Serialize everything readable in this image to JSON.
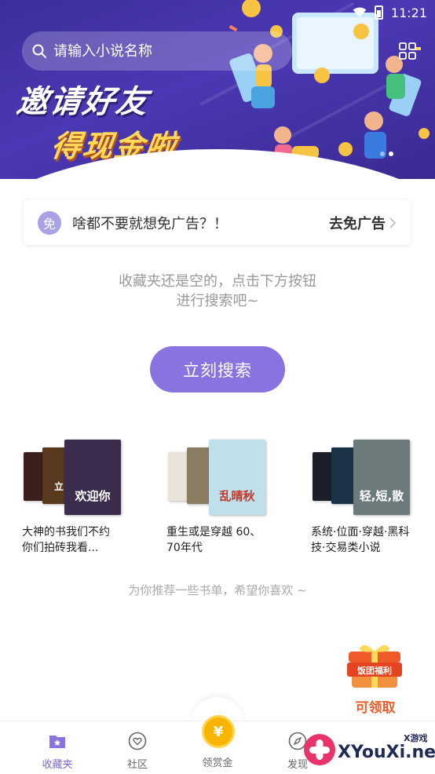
{
  "status": {
    "time": "11:21"
  },
  "search": {
    "placeholder": "请输入小说名称"
  },
  "banner": {
    "line1": "邀请好友",
    "line2": "得现金啦",
    "slide_count": 2,
    "active_slide": 2
  },
  "ad_free": {
    "badge": "免",
    "text": "啥都不要就想免广告？！",
    "action": "去免广告"
  },
  "empty_state": {
    "line1": "收藏夹还是空的，点击下方按钮",
    "line2": "进行搜索吧~",
    "button": "立刻搜索"
  },
  "book_lists": [
    {
      "title_line1": "大神的书我们不约",
      "title_line2": "你们拍砖我看...",
      "covers": [
        {
          "text": "",
          "color": "#3a1f1a"
        },
        {
          "text": "立",
          "color": "#5a3a1e"
        },
        {
          "text": "欢迎你",
          "color": "#3c2d4e"
        }
      ]
    },
    {
      "title_line1": "重生或是穿越 60、",
      "title_line2": "70年代",
      "covers": [
        {
          "text": "",
          "color": "#e9e4da"
        },
        {
          "text": "",
          "color": "#8b7d62"
        },
        {
          "text": "乱晴秋",
          "color": "#bfe0ea"
        }
      ]
    },
    {
      "title_line1": "系统·位面·穿越·黑科",
      "title_line2": "技·交易类小说",
      "covers": [
        {
          "text": "",
          "color": "#1a1f2a"
        },
        {
          "text": "",
          "color": "#1d3348"
        },
        {
          "text": "轻,短,散",
          "color": "#6c7a7c"
        }
      ]
    }
  ],
  "recommend_text": "为你推荐一些书单，希望你喜欢 ~",
  "gift": {
    "badge": "饭团福利",
    "label": "可领取"
  },
  "tabs": [
    {
      "label": "收藏夹",
      "icon": "bookshelf-icon",
      "active": true
    },
    {
      "label": "社区",
      "icon": "heart-chat-icon",
      "active": false
    },
    {
      "label": "领赏金",
      "icon": "yuan-coin-icon",
      "active": false
    },
    {
      "label": "发现",
      "icon": "compass-icon",
      "active": false
    }
  ],
  "coin_symbol": "¥",
  "watermark": {
    "brand": "XYouXi.net",
    "small": "X游戏"
  },
  "colors": {
    "accent": "#8873e0",
    "banner": "#3c2f9c",
    "gift": "#f05a28"
  }
}
